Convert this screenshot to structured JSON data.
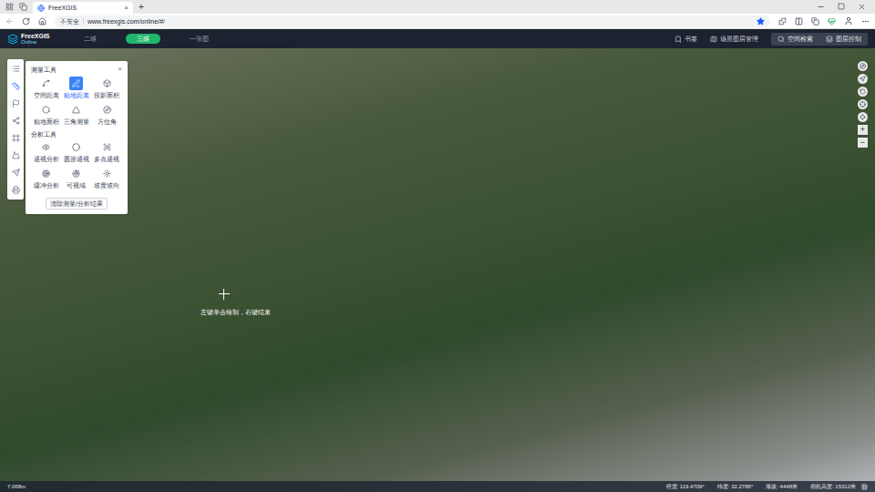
{
  "browser": {
    "tab_title": "FreeXGIS",
    "close": "×",
    "new_tab": "+",
    "security": "不安全",
    "url": "www.freexgis.com/online/#/"
  },
  "header": {
    "logo_title": "FreeXGIS",
    "logo_subtitle": "Online",
    "tabs": [
      {
        "label": "二维",
        "selected": false
      },
      {
        "label": "三维",
        "selected": true
      },
      {
        "label": "一张图",
        "selected": false
      }
    ],
    "actions": [
      "书签",
      "场景图层管理"
    ],
    "buttons": [
      "空间检索",
      "图层控制"
    ]
  },
  "left_toolbar": {
    "items": [
      {
        "selected": false
      },
      {
        "selected": true
      },
      {
        "selected": false
      },
      {
        "selected": false
      },
      {
        "selected": false
      },
      {
        "selected": false
      },
      {
        "selected": false
      },
      {
        "selected": false
      }
    ]
  },
  "panel": {
    "title": "测量工具",
    "close": "×",
    "sections": [
      {
        "title": "",
        "items": [
          {
            "label": "空间距离",
            "selected": false
          },
          {
            "label": "贴地距离",
            "selected": true
          },
          {
            "label": "投影面积",
            "selected": false
          },
          {
            "label": "贴地面积",
            "selected": false
          },
          {
            "label": "三角测量",
            "selected": false
          },
          {
            "label": "方位角",
            "selected": false
          }
        ]
      },
      {
        "title": "分析工具",
        "items": [
          {
            "label": "通视分析",
            "selected": false
          },
          {
            "label": "圆形通视",
            "selected": false
          },
          {
            "label": "多点通视",
            "selected": false
          },
          {
            "label": "缓冲分析",
            "selected": false
          },
          {
            "label": "可视域",
            "selected": false
          },
          {
            "label": "坡度坡向",
            "selected": false
          }
        ]
      }
    ],
    "clear_button": "清除测量/分析结果"
  },
  "map_controls": {
    "zoom": [
      "+",
      "−"
    ]
  },
  "map": {
    "hint": "左键单击绘制，右键结束"
  },
  "status_bar": {
    "scale": "7.068m",
    "readouts": [
      "经度: 119.4709°",
      "纬度: 32.2788°",
      "海拔: 4448米",
      "相机高度: 15312米"
    ]
  }
}
